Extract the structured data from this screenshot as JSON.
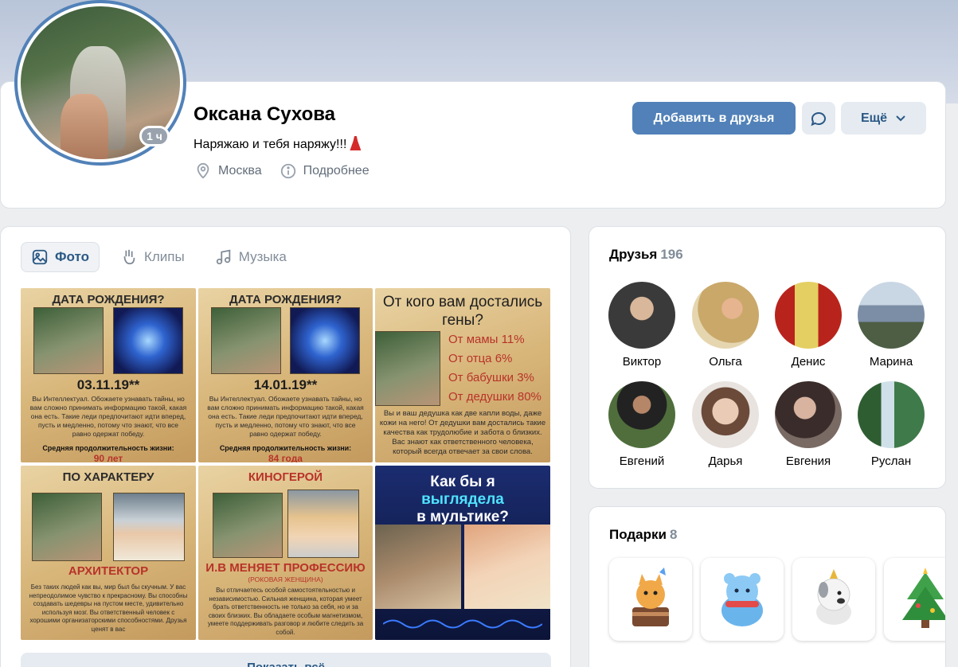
{
  "profile": {
    "name": "Оксана Сухова",
    "status": "Наряжаю и тебя наряжу!!!",
    "online": "1 ч",
    "city": "Москва",
    "details": "Подробнее"
  },
  "actions": {
    "add_friend": "Добавить в друзья",
    "more": "Ещё"
  },
  "tabs": [
    {
      "label": "Фото",
      "icon": "image-icon",
      "active": true
    },
    {
      "label": "Клипы",
      "icon": "clips-icon",
      "active": false
    },
    {
      "label": "Музыка",
      "icon": "music-icon",
      "active": false
    }
  ],
  "photos": [
    {
      "title": "ДАТА РОЖДЕНИЯ?",
      "date": "03.11.19**",
      "text": "Вы Интеллектуал. Обожаете узнавать тайны, но вам сложно принимать информацию такой, какая она есть. Такие леди предпочитают идти вперед, пусть и медленно, потому что знают, что все равно одержат победу.",
      "life_label": "Средняя продолжительность жизни:",
      "life_value": "90 лет"
    },
    {
      "title": "ДАТА РОЖДЕНИЯ?",
      "date": "14.01.19**",
      "text": "Вы Интеллектуал. Обожаете узнавать тайны, но вам сложно принимать информацию такой, какая она есть. Такие леди предпочитают идти вперед, пусть и медленно, потому что знают, что все равно одержат победу.",
      "life_label": "Средняя продолжительность жизни:",
      "life_value": "84 года"
    },
    {
      "title": "От кого вам достались гены?",
      "lines": [
        "От мамы 11%",
        "От отца 6%",
        "От бабушки 3%",
        "От дедушки 80%"
      ],
      "text": "Вы и ваш дедушка как две капли воды, даже кожи на него! От дедушки вам достались такие качества как трудолюбие и забота о близких. Вас знают как ответственного человека, который всегда отвечает за свои слова."
    },
    {
      "title": "ПО ХАРАКТЕРУ",
      "profession": "АРХИТЕКТОР",
      "text": "Без таких людей как вы, мир был бы скучным. У вас непреодолимое чувство к прекрасному. Вы способны создавать шедевры на пустом месте, удивительно используя мозг. Вы ответственный человек с хорошими организаторскими способностями. Друзья ценят в вас"
    },
    {
      "title": "КИНОГЕРОЙ",
      "profession": "И.В МЕНЯЕТ ПРОФЕССИЮ",
      "subtitle": "(РОКОВАЯ ЖЕНЩИНА)",
      "text": "Вы отличаетесь особой самостоятельностью и независимостью. Сильная женщина, которая умеет брать ответственность не только за себя, но и за своих близких. Вы обладаете особым магнетизмом, умеете поддерживать разговор и любите следить за собой."
    },
    {
      "line1": "Как бы я",
      "line2": "выглядела",
      "line3": "в мультике?"
    }
  ],
  "show_all": "Показать всё",
  "friends": {
    "title": "Друзья",
    "count": "196",
    "items": [
      {
        "name": "Виктор",
        "color": "#3a3a3a"
      },
      {
        "name": "Ольга",
        "color": "#c9a86a"
      },
      {
        "name": "Денис",
        "color": "#c23a2e"
      },
      {
        "name": "Марина",
        "color": "#7c8ea6"
      },
      {
        "name": "Евгений",
        "color": "#4f6e3c"
      },
      {
        "name": "Дарья",
        "color": "#d9c0ad"
      },
      {
        "name": "Евгения",
        "color": "#5a4a46"
      },
      {
        "name": "Руслан",
        "color": "#3f7a4a"
      }
    ]
  },
  "gifts": {
    "title": "Подарки",
    "count": "8",
    "items": [
      "cat-cake-icon",
      "blue-bear-icon",
      "white-dog-icon",
      "christmas-tree-icon"
    ]
  },
  "colors": {
    "accent": "#5181b8",
    "link": "#2a5885",
    "secondary_text": "#818c99",
    "page_bg": "#edeef0"
  }
}
